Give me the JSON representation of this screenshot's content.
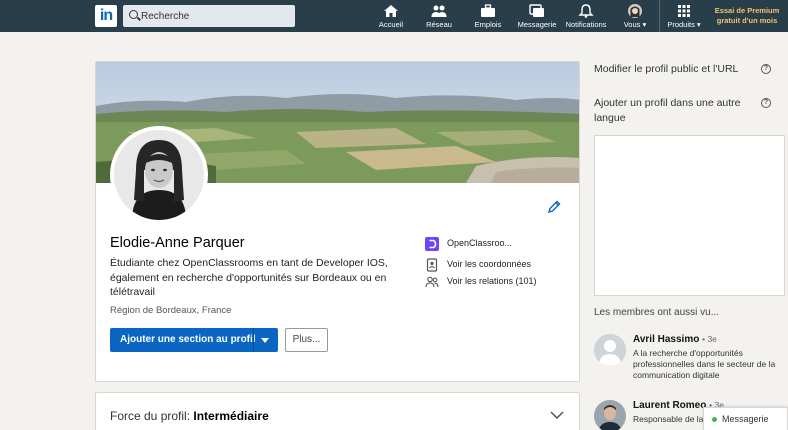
{
  "nav": {
    "logo": "in",
    "search_placeholder": "Recherche",
    "items": [
      {
        "label": "Accueil",
        "icon": "home-icon"
      },
      {
        "label": "Réseau",
        "icon": "network-icon"
      },
      {
        "label": "Emplois",
        "icon": "briefcase-icon"
      },
      {
        "label": "Messagerie",
        "icon": "messaging-icon"
      },
      {
        "label": "Notifications",
        "icon": "bell-icon"
      },
      {
        "label": "Vous",
        "icon": "avatar"
      },
      {
        "label": "Produits",
        "icon": "grid-icon"
      }
    ],
    "premium": "Essai de Premium gratuit d'un mois"
  },
  "profile": {
    "name": "Elodie-Anne Parquer",
    "headline": "Étudiante chez OpenClassrooms en tant de Developer IOS, également en recherche d'opportunités sur Bordeaux ou en télétravail",
    "location": "Région de Bordeaux, France",
    "school": "OpenClassroo...",
    "contact_link": "Voir les coordonnées",
    "connections_link": "Voir les relations (101)",
    "add_section_button": "Ajouter une section au profil",
    "more_button": "Plus..."
  },
  "strength": {
    "label": "Force du profil: ",
    "value": "Intermédiaire"
  },
  "rail": {
    "edit_public_profile": "Modifier le profil public et l'URL",
    "add_language_profile": "Ajouter un profil dans une autre langue",
    "help_glyph": "?",
    "also_viewed_title": "Les membres ont aussi vu...",
    "members": [
      {
        "name": "Avril Hassimo",
        "degree": "• 3e",
        "desc": "A la recherche d'opportunités professionnelles dans le secteur de la communication digitale"
      },
      {
        "name": "Laurent Romeo",
        "degree": "• 3e",
        "desc": "Responsable de la"
      }
    ]
  },
  "messaging_bar": "Messagerie",
  "colors": {
    "nav_bg": "#283e4a",
    "primary": "#0a66c2",
    "premium": "#f5c26b",
    "online": "#4caf50"
  }
}
